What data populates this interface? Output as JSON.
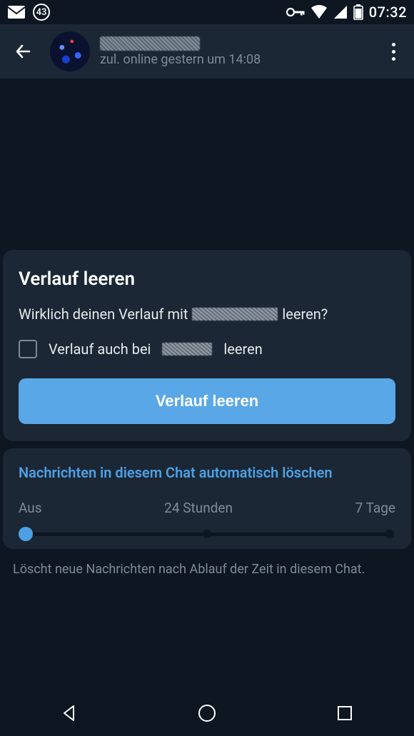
{
  "status": {
    "notification_count": "43",
    "clock": "07:32"
  },
  "header": {
    "last_seen": "zul. online gestern um 14:08"
  },
  "dialog": {
    "title": "Verlauf leeren",
    "confirm_prefix": "Wirklich deinen Verlauf mit",
    "confirm_suffix": "leeren?",
    "checkbox_prefix": "Verlauf auch bei",
    "checkbox_suffix": "leeren",
    "primary_button": "Verlauf leeren"
  },
  "autodelete": {
    "title": "Nachrichten in diesem Chat automatisch löschen",
    "options": [
      "Aus",
      "24 Stunden",
      "7 Tage"
    ],
    "selected_index": 0,
    "footer": "Löscht neue Nachrichten nach Ablauf der Zeit in diesem Chat."
  }
}
